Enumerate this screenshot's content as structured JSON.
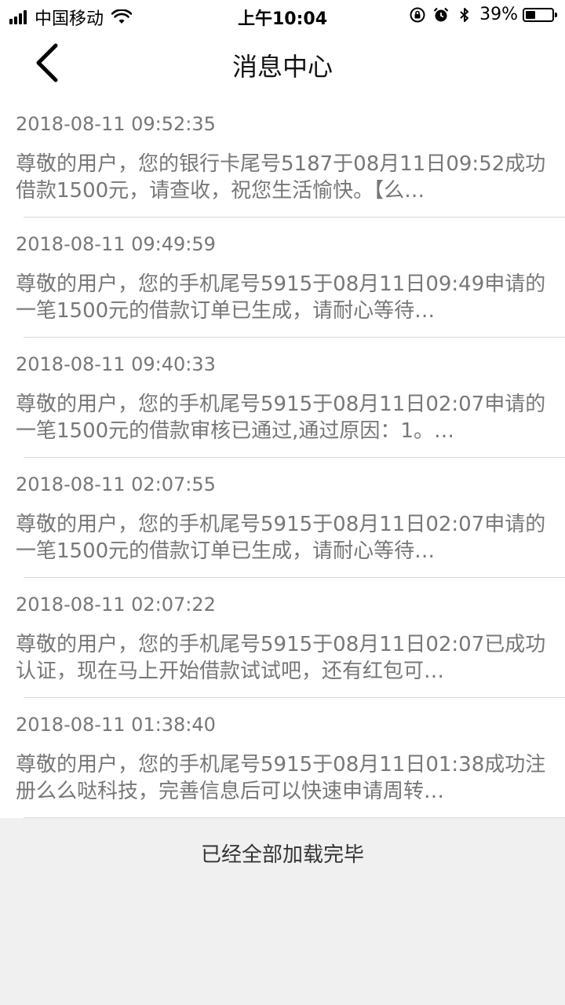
{
  "status_bar": {
    "carrier": "中国移动",
    "time": "上午10:04",
    "battery_percent": "39%",
    "battery_level": 0.39
  },
  "nav": {
    "title": "消息中心",
    "back_icon": "chevron-left-icon"
  },
  "messages": [
    {
      "time": "2018-08-11 09:52:35",
      "body": "尊敬的用户，您的银行卡尾号5187于08月11日09:52成功借款1500元，请查收，祝您生活愉快。【么…"
    },
    {
      "time": "2018-08-11 09:49:59",
      "body": "尊敬的用户，您的手机尾号5915于08月11日09:49申请的一笔1500元的借款订单已生成，请耐心等待…"
    },
    {
      "time": "2018-08-11 09:40:33",
      "body": "尊敬的用户，您的手机尾号5915于08月11日02:07申请的一笔1500元的借款审核已通过,通过原因：1。…"
    },
    {
      "time": "2018-08-11 02:07:55",
      "body": "尊敬的用户，您的手机尾号5915于08月11日02:07申请的一笔1500元的借款订单已生成，请耐心等待…"
    },
    {
      "time": "2018-08-11 02:07:22",
      "body": "尊敬的用户，您的手机尾号5915于08月11日02:07已成功认证，现在马上开始借款试试吧，还有红包可…"
    },
    {
      "time": "2018-08-11 01:38:40",
      "body": "尊敬的用户，您的手机尾号5915于08月11日01:38成功注册么么哒科技，完善信息后可以快速申请周转…"
    }
  ],
  "footer": {
    "text": "已经全部加载完毕"
  }
}
